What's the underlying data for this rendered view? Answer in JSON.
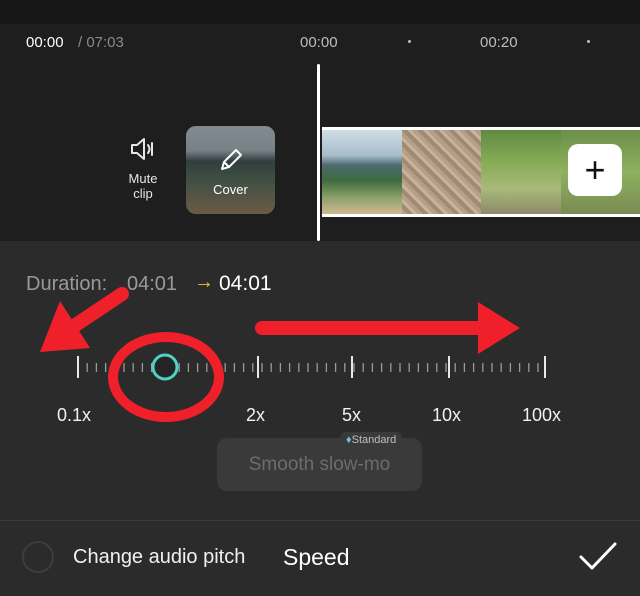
{
  "timeline": {
    "current_time": "00:00",
    "total_time": "/ 07:03",
    "ruler_marks": [
      "00:00",
      "00:20"
    ]
  },
  "clip_tools": {
    "mute_label_line1": "Mute",
    "mute_label_line2": "clip",
    "cover_label": "Cover",
    "add_button": "+"
  },
  "speed": {
    "duration_label": "Duration:",
    "duration_old": "04:01",
    "duration_arrow": "→",
    "duration_new": "04:01",
    "scale_labels": [
      "0.1x",
      "2x",
      "5x",
      "10x",
      "100x"
    ],
    "badge_text": "Standard",
    "smooth_button": "Smooth slow-mo"
  },
  "footer": {
    "pitch_label": "Change audio pitch",
    "title": "Speed"
  },
  "colors": {
    "knob": "#4fd1c5",
    "annotation": "#f0202a",
    "arrow_yellow": "#f2c037"
  },
  "icons": [
    "speaker-icon",
    "pencil-icon",
    "plus-icon",
    "diamond-icon",
    "checkmark-icon"
  ]
}
